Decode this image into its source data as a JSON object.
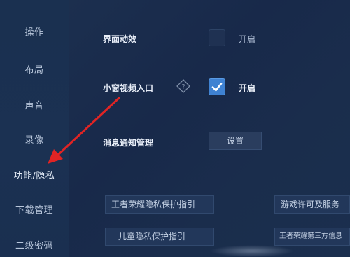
{
  "sidebar": {
    "items": [
      {
        "label": "操作"
      },
      {
        "label": "布局"
      },
      {
        "label": "声音"
      },
      {
        "label": "录像"
      },
      {
        "label": "功能/隐私"
      },
      {
        "label": "下载管理"
      },
      {
        "label": "二级密码"
      }
    ],
    "active_index": 4
  },
  "settings": {
    "interface_animation": {
      "label": "界面动效",
      "checked": false,
      "checkbox_text": "开启"
    },
    "mini_video_entry": {
      "label": "小窗视频入口",
      "help_icon": "question-diamond-icon",
      "checked": true,
      "checkbox_text": "开启"
    },
    "notification_management": {
      "label": "消息通知管理",
      "button_label": "设置"
    }
  },
  "links": {
    "privacy_guide": "王者荣耀隐私保护指引",
    "game_license": "游戏许可及服务",
    "child_privacy_guide": "儿童隐私保护指引",
    "third_party_info": "王者荣耀第三方信息"
  },
  "annotation": {
    "arrow_color": "#e02424"
  },
  "colors": {
    "background": "#1b2f4e",
    "accent_checkbox": "#3f82d2"
  }
}
